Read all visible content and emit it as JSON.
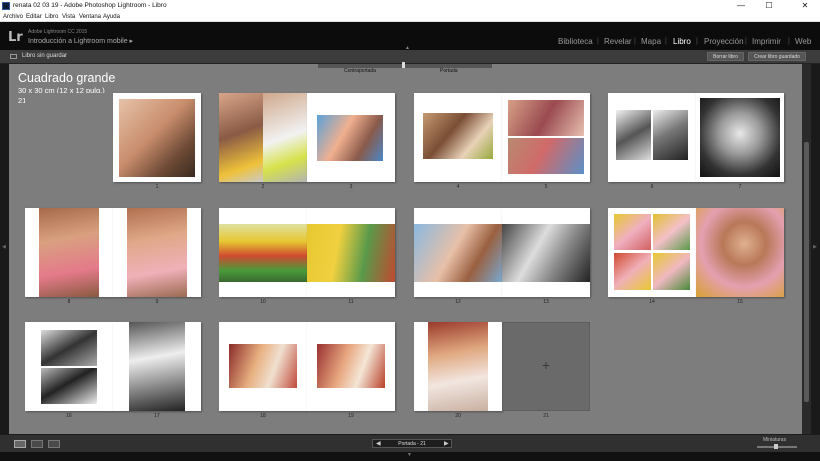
{
  "window": {
    "title": "renata 02 03 19 - Adobe Photoshop Lightroom - Libro",
    "minimize": "—",
    "maximize": "☐",
    "close": "✕"
  },
  "menu": [
    "Archivo",
    "Editar",
    "Libro",
    "Vista",
    "Ventana",
    "Ayuda"
  ],
  "identity": {
    "logo": "Lr",
    "product": "Adobe Lightroom CC 2015",
    "catalog": "Introducción a Lightroom mobile ▸"
  },
  "modules": [
    "Biblioteca",
    "Revelar",
    "Mapa",
    "Libro",
    "Proyección",
    "Imprimir",
    "Web"
  ],
  "active_module": "Libro",
  "module_separator": "|",
  "toolbar": {
    "book_title": "Libro sin guardar",
    "clear": "Borrar libro",
    "create": "Crear libro guardado"
  },
  "cover_slider": {
    "left": "Contraportada",
    "right": "Portada"
  },
  "book": {
    "format": "Cuadrado grande",
    "size": "30 x 30 cm (12 x 12 pulg.)",
    "pages": "21 páginas"
  },
  "spreads": [
    {
      "left": null,
      "right": "1"
    },
    {
      "left": "2",
      "right": "3"
    },
    {
      "left": "4",
      "right": "5"
    },
    {
      "left": "6",
      "right": "7"
    },
    {
      "left": "8",
      "right": "9"
    },
    {
      "left": "10",
      "right": "11"
    },
    {
      "left": "12",
      "right": "13"
    },
    {
      "left": "14",
      "right": "15"
    },
    {
      "left": "16",
      "right": "17"
    },
    {
      "left": "18",
      "right": "19"
    },
    {
      "left": "20",
      "right": "21"
    }
  ],
  "empty_page_symbol": "+",
  "nav": {
    "prev": "◀",
    "label": "Portada - 21",
    "next": "▶"
  },
  "thumbnails_label": "Miniaturas",
  "collapse_arrow": "▲",
  "expand_arrow": "▼",
  "side_arrow_left": "◀",
  "side_arrow_right": "▶"
}
